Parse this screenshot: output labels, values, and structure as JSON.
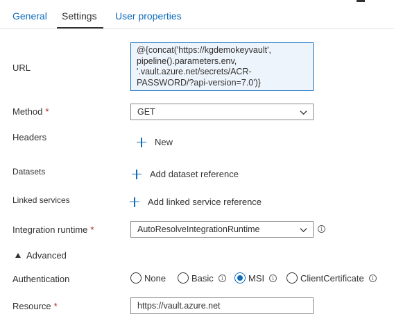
{
  "tabs": [
    {
      "label": "General"
    },
    {
      "label": "Settings"
    },
    {
      "label": "User properties"
    }
  ],
  "url": {
    "label": "URL",
    "value": "@{concat('https://kgdemokeyvault',\npipeline().parameters.env,\n'.vault.azure.net/secrets/ACR-\nPASSWORD/?api-version=7.0')}"
  },
  "method": {
    "label": "Method",
    "required": "*",
    "value": "GET"
  },
  "headers": {
    "label": "Headers",
    "new_label": "New"
  },
  "datasets": {
    "label": "Datasets",
    "add_label": "Add dataset reference"
  },
  "linked_services": {
    "label": "Linked services",
    "add_label": "Add linked service reference"
  },
  "integration_runtime": {
    "label": "Integration runtime",
    "required": "*",
    "value": "AutoResolveIntegrationRuntime"
  },
  "advanced": {
    "label": "Advanced"
  },
  "authentication": {
    "label": "Authentication",
    "options": [
      {
        "label": "None",
        "checked": false
      },
      {
        "label": "Basic",
        "checked": false
      },
      {
        "label": "MSI",
        "checked": true
      },
      {
        "label": "ClientCertificate",
        "checked": false
      }
    ]
  },
  "resource": {
    "label": "Resource",
    "required": "*",
    "value": "https://vault.azure.net"
  },
  "info_glyph": "i",
  "colors": {
    "accent": "#0f6cbd",
    "required": "#a4262c",
    "url_bg": "#eef4fb"
  }
}
